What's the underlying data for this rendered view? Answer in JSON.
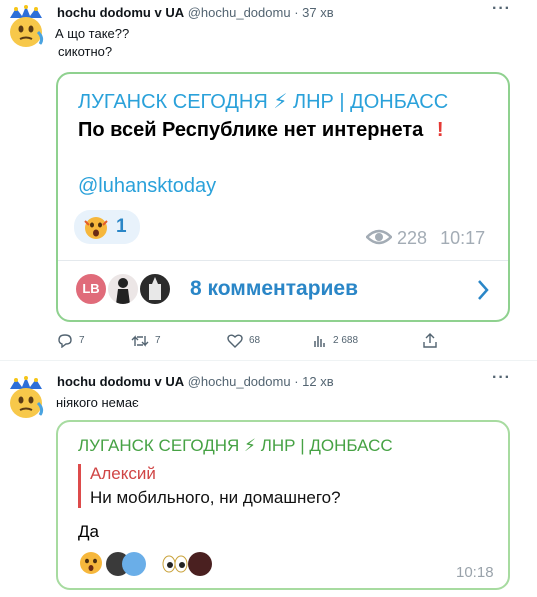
{
  "tweet1": {
    "name": "hochu dodomu v UA",
    "handle": "@hochu_dodomu",
    "time": "37 хв",
    "line1": "А що таке??",
    "line2": "сикотно?",
    "more": "···"
  },
  "tg1": {
    "channel": "ЛУГАНСК СЕГОДНЯ ⚡ ЛНР | ДОНБАСС",
    "text": "По всей Республике нет интернета",
    "link": "@luhansktoday",
    "reaction_count": "1",
    "views": "228",
    "time": "10:17",
    "comments_label": "8 комментариев",
    "avatar_initials": "LB",
    "colors": {
      "title": "#2aa1da",
      "accent": "#2a86c7",
      "exclaim": "#e53935"
    }
  },
  "actions": {
    "replies": "7",
    "retweets": "7",
    "likes": "68",
    "views": "2 688"
  },
  "tweet2": {
    "name": "hochu dodomu v UA",
    "handle": "@hochu_dodomu",
    "time": "12 хв",
    "text": "ніякого немає"
  },
  "tg2": {
    "channel": "ЛУГАНСК СЕГОДНЯ ⚡ ЛНР | ДОНБАСС",
    "quote_author": "Алексий",
    "quote_text": "Ни мобильного, ни домашнего?",
    "body": "Да",
    "time": "10:18",
    "colors": {
      "title": "#46a244",
      "quote": "#d04545"
    }
  }
}
